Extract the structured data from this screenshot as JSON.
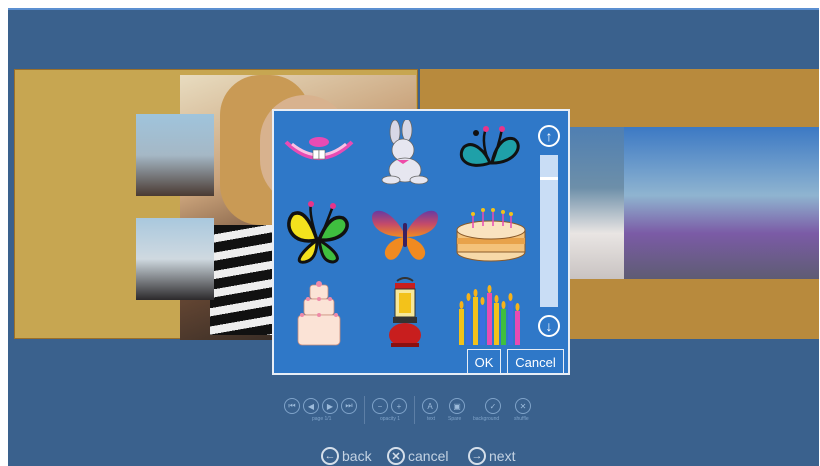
{
  "dialog": {
    "ok_label": "OK",
    "cancel_label": "Cancel",
    "clipart": [
      "mouth-smile",
      "bunny",
      "butterfly-teal",
      "butterfly-yellow-green",
      "butterfly-purple-orange",
      "birthday-cake",
      "wedding-cake",
      "lantern",
      "candles"
    ],
    "scroll_up_icon": "arrow-up-circle-icon",
    "scroll_down_icon": "arrow-down-circle-icon"
  },
  "toolbar": {
    "page_label": "page 1/1",
    "opacity_label": "opacity 1",
    "text_label": "text",
    "spare_label": "Spare",
    "background_label": "background",
    "shuffle_label": "shuffle"
  },
  "nav": {
    "back_label": "back",
    "cancel_label": "cancel",
    "next_label": "next"
  },
  "colors": {
    "background": "#3a618d",
    "dialog": "#2f78c8",
    "page_left": "#c7a651",
    "page_right": "#b88a3d"
  }
}
